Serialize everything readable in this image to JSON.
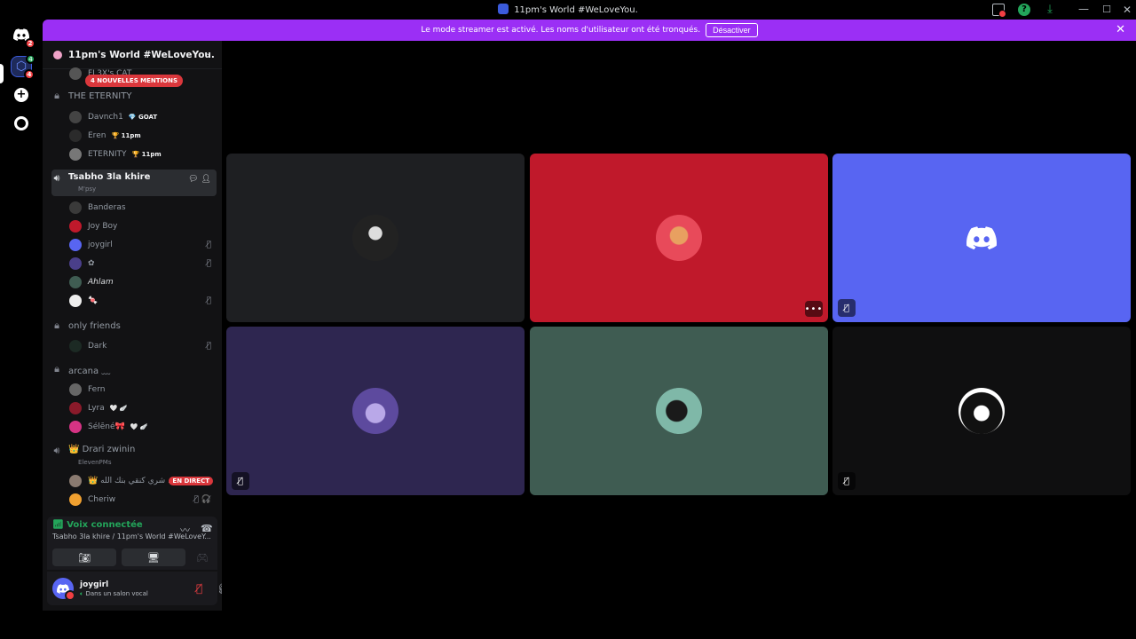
{
  "window": {
    "title": "11pm's World #WeLoveYou."
  },
  "rail": {
    "dm_badge": "2",
    "server_badge_top": "4",
    "server_badge_bottom": "4",
    "add_label": "+"
  },
  "banner": {
    "text": "Le mode streamer est activé. Les noms d'utilisateur ont été tronqués.",
    "button": "Désactiver",
    "close": "✕"
  },
  "server": {
    "name": "11pm's World #WeLoveYou.",
    "chevron": "⌄"
  },
  "mentions": "4 NOUVELLES MENTIONS",
  "channels": {
    "partial_top": "FL3X's CAT",
    "eternity": {
      "name": "THE ETERNITY",
      "users": [
        {
          "name": "Davnch1",
          "tag": "💎 GOAT"
        },
        {
          "name": "Eren",
          "tag": "🏆 11pm"
        },
        {
          "name": "ETERNITY",
          "tag": "🏆 11pm"
        }
      ]
    },
    "tsabho": {
      "name": "Tsabho 3la khire",
      "sub": "M'psy",
      "users": [
        {
          "name": "Banderas"
        },
        {
          "name": "Joy Boy"
        },
        {
          "name": "joygirl"
        },
        {
          "name": "✿"
        },
        {
          "name": "Ahlam"
        },
        {
          "name": "🍬"
        }
      ]
    },
    "only_friends": {
      "name": "only friends",
      "users": [
        {
          "name": "Dark"
        }
      ]
    },
    "arcana": {
      "name": "arcana ﹏",
      "users": [
        {
          "name": "Fern",
          "tag": ""
        },
        {
          "name": "Lyra",
          "tag": "🤍 🪽"
        },
        {
          "name": "Sélēné🎀",
          "tag": "🤍 🪽"
        }
      ]
    },
    "drari": {
      "name": "👑 Drari zwinin",
      "sub": "ElevenPMs",
      "users": [
        {
          "name": "👑 شري كنقي بنك الله ...",
          "live": "EN DIRECT"
        },
        {
          "name": "Cheriw"
        }
      ]
    }
  },
  "voice": {
    "status": "Voix connectée",
    "channel": "Tsabho 3la khire / 11pm's World #WeLoveY..."
  },
  "user": {
    "name": "joygirl",
    "status": "Dans un salon vocal"
  },
  "tiles": {
    "colors": [
      "#1e1f22",
      "#c0192b",
      "#5865f2",
      "#2e2650",
      "#3f5c52",
      "#0f0f10"
    ]
  }
}
